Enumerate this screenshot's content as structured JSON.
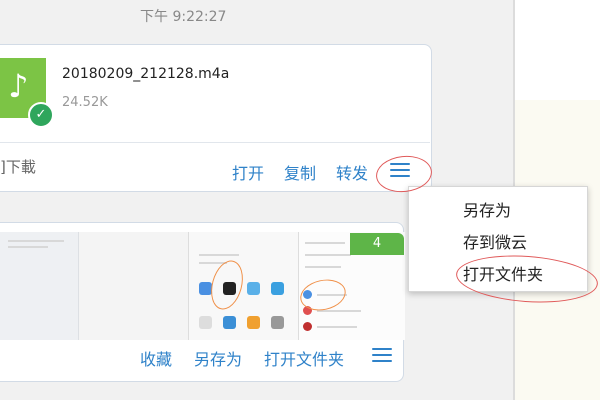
{
  "timestamp": "下午 9:22:27",
  "file_card": {
    "file_name": "20180209_212128.m4a",
    "file_size": "24.52K",
    "status_text": "]下載",
    "actions": {
      "open": "打开",
      "copy": "复制",
      "forward": "转发"
    }
  },
  "dropdown": {
    "items": [
      "另存为",
      "存到微云",
      "打开文件夹"
    ]
  },
  "image_card": {
    "badge": "4",
    "actions": {
      "favorite": "收藏",
      "save_as": "另存为",
      "open_folder": "打开文件夹"
    }
  },
  "icons": {
    "file": "music-note-icon",
    "check": "check-icon",
    "menu": "hamburger-menu-icon"
  },
  "colors": {
    "accent": "#2f82c9",
    "file_green": "#7cc445",
    "check_green": "#2fa65c",
    "annotation_red": "#e05a5a"
  }
}
